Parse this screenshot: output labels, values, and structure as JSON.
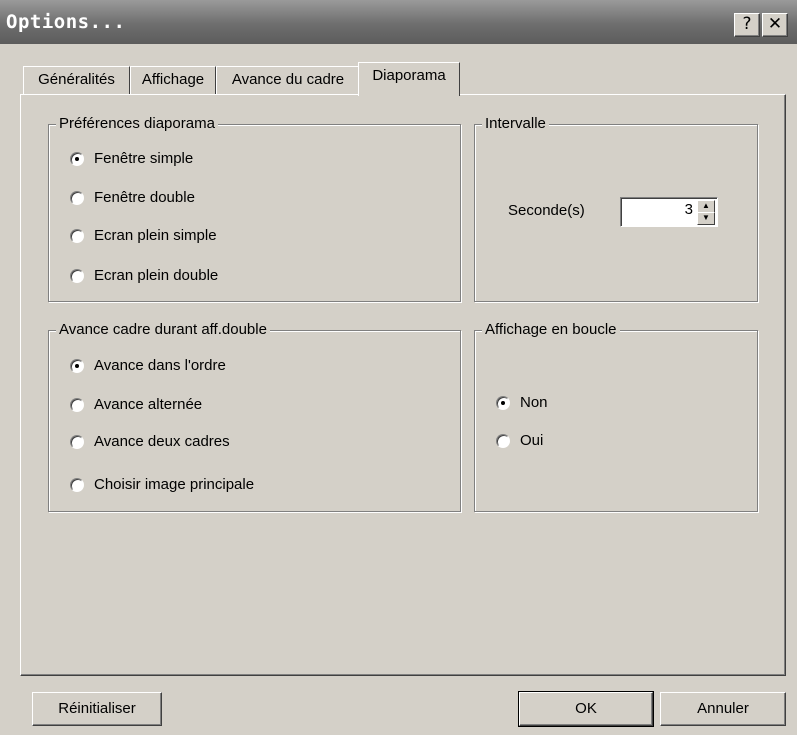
{
  "window": {
    "title": "Options...",
    "help_label": "?",
    "close_label": "✕"
  },
  "tabs": [
    {
      "label": "Généralités"
    },
    {
      "label": "Affichage"
    },
    {
      "label": "Avance du cadre"
    },
    {
      "label": "Diaporama",
      "active": true
    }
  ],
  "prefs": {
    "title": "Préférences diaporama",
    "options": [
      "Fenêtre simple",
      "Fenêtre double",
      "Ecran plein simple",
      "Ecran plein double"
    ],
    "selected": "Fenêtre simple"
  },
  "interval": {
    "title": "Intervalle",
    "label": "Seconde(s)",
    "value": "3"
  },
  "advance": {
    "title": "Avance cadre durant aff.double",
    "options": [
      "Avance dans l'ordre",
      "Avance alternée",
      "Avance deux cadres",
      "Choisir image principale"
    ],
    "selected": "Avance dans l'ordre"
  },
  "loop": {
    "title": "Affichage en boucle",
    "options": [
      "Non",
      "Oui"
    ],
    "selected": "Non"
  },
  "buttons": {
    "reset": "Réinitialiser",
    "ok": "OK",
    "cancel": "Annuler"
  }
}
